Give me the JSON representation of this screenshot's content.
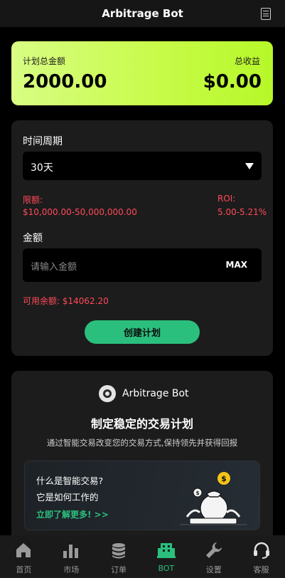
{
  "header": {
    "title": "Arbitrage Bot",
    "doc_icon": "document-icon"
  },
  "summary": {
    "plan_total_label": "计划总金额",
    "plan_total_value": "2000.00",
    "total_profit_label": "总收益",
    "total_profit_value": "$0.00"
  },
  "plan_form": {
    "period_label": "时间周期",
    "period_value": "30天",
    "limit_label": "限额:",
    "limit_value": "$10,000.00-50,000,000.00",
    "roi_label": "ROI:",
    "roi_value": "5.00-5.21%",
    "amount_label": "金额",
    "amount_placeholder": "请输入金额",
    "max_label": "MAX",
    "balance_text": "可用余额: $14062.20",
    "create_button": "创建计划"
  },
  "info": {
    "brand_name": "Arbitrage Bot",
    "headline": "制定稳定的交易计划",
    "subtitle": "通过智能交易改变您的交易方式,保持领先并获得回报",
    "question_1": "什么是智能交易?",
    "question_2": "它是如何工作的",
    "learn_more": "立即了解更多! >>"
  },
  "nav": {
    "active_index": 3,
    "items": [
      {
        "label": "首页",
        "icon": "home-icon"
      },
      {
        "label": "市场",
        "icon": "bar-chart-icon"
      },
      {
        "label": "订单",
        "icon": "coins-stack-icon"
      },
      {
        "label": "BOT",
        "icon": "bot-icon"
      },
      {
        "label": "设置",
        "icon": "wrench-icon"
      },
      {
        "label": "客服",
        "icon": "headset-icon"
      }
    ]
  },
  "colors": {
    "accent_green": "#2bbf7e",
    "warning_red": "#ff4a5a",
    "summary_gradient_start": "#d8fd84",
    "summary_gradient_end": "#b6f829",
    "card_bg": "#1c1c1c"
  }
}
